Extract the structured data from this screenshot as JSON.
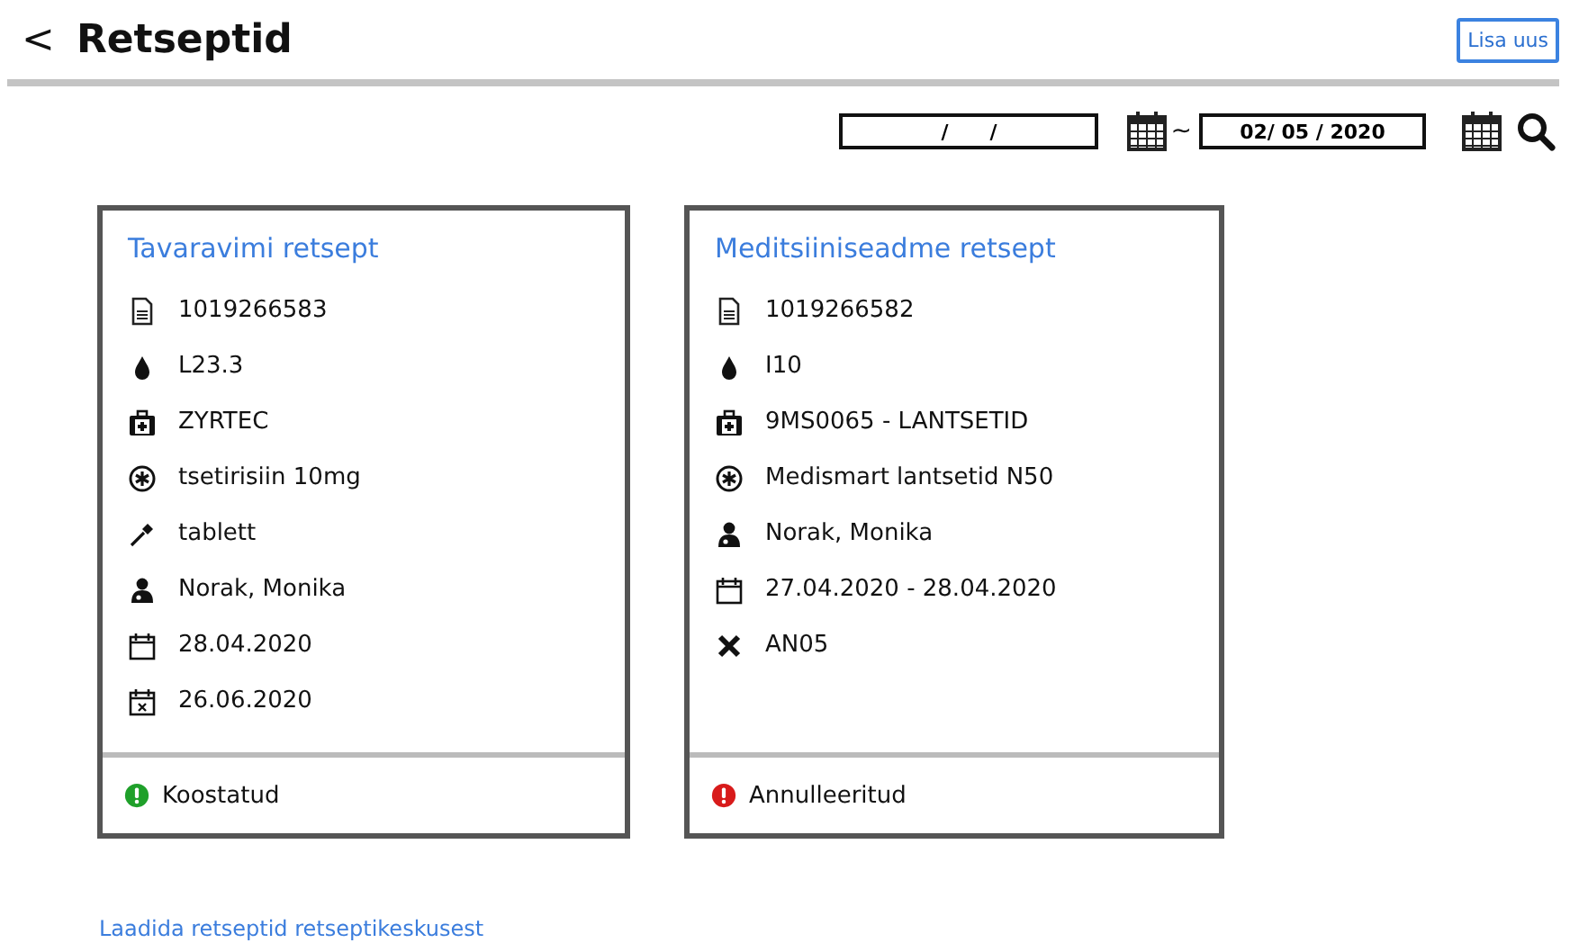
{
  "header": {
    "back": "<",
    "title": "Retseptid",
    "add_button": "Lisa uus"
  },
  "filter": {
    "from": "/      /",
    "to": "02/ 05 / 2020",
    "separator": "~"
  },
  "cards": [
    {
      "title": "Tavaravimi retsept",
      "rows": [
        {
          "kind": "document",
          "text": "1019266583"
        },
        {
          "kind": "drop",
          "text": "L23.3"
        },
        {
          "kind": "medkit",
          "text": "ZYRTEC"
        },
        {
          "kind": "asterisk",
          "text": "tsetirisiin 10mg"
        },
        {
          "kind": "dropper",
          "text": "tablett"
        },
        {
          "kind": "doctor",
          "text": "Norak, Monika"
        },
        {
          "kind": "calendar",
          "text": "28.04.2020"
        },
        {
          "kind": "calendar-x",
          "text": "26.06.2020"
        }
      ],
      "status": {
        "text": "Koostatud",
        "color": "#1fa02a"
      }
    },
    {
      "title": "Meditsiiniseadme retsept",
      "rows": [
        {
          "kind": "document",
          "text": "1019266582"
        },
        {
          "kind": "drop",
          "text": "I10"
        },
        {
          "kind": "medkit",
          "text": "9MS0065 - LANTSETID"
        },
        {
          "kind": "asterisk",
          "text": "Medismart lantsetid N50"
        },
        {
          "kind": "doctor",
          "text": "Norak, Monika"
        },
        {
          "kind": "calendar",
          "text": "27.04.2020 - 28.04.2020"
        },
        {
          "kind": "cross",
          "text": "AN05"
        }
      ],
      "status": {
        "text": "Annulleeritud",
        "color": "#d81b1b"
      }
    }
  ],
  "footer_link": "Laadida retseptid retseptikeskusest"
}
